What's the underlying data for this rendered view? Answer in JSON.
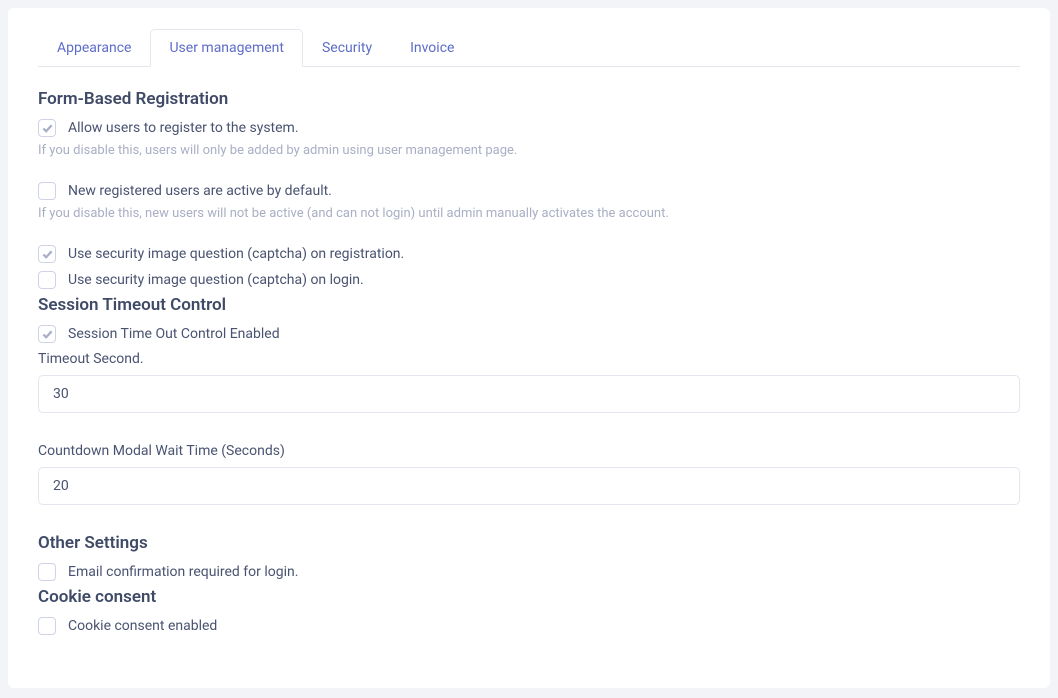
{
  "tabs": {
    "appearance": "Appearance",
    "user_management": "User management",
    "security": "Security",
    "invoice": "Invoice"
  },
  "form_registration": {
    "title": "Form-Based Registration",
    "allow_register_label": "Allow users to register to the system.",
    "allow_register_hint": "If you disable this, users will only be added by admin using user management page.",
    "active_default_label": "New registered users are active by default.",
    "active_default_hint": "If you disable this, new users will not be active (and can not login) until admin manually activates the account.",
    "captcha_register_label": "Use security image question (captcha) on registration.",
    "captcha_login_label": "Use security image question (captcha) on login."
  },
  "session_timeout": {
    "title": "Session Timeout Control",
    "enabled_label": "Session Time Out Control Enabled",
    "timeout_second_label": "Timeout Second.",
    "timeout_second_value": "30",
    "countdown_label": "Countdown Modal Wait Time (Seconds)",
    "countdown_value": "20"
  },
  "other_settings": {
    "title": "Other Settings",
    "email_confirm_label": "Email confirmation required for login."
  },
  "cookie_consent": {
    "title": "Cookie consent",
    "enabled_label": "Cookie consent enabled"
  }
}
